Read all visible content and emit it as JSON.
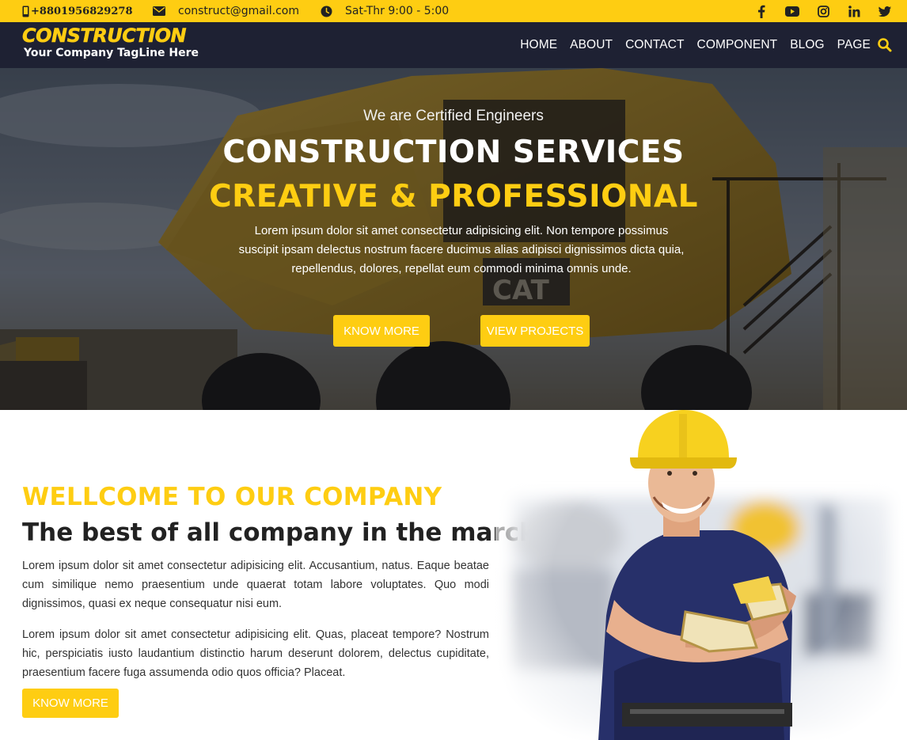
{
  "topbar": {
    "phone": "+8801956829278",
    "email": "construct@gmail.com",
    "hours": "Sat-Thr 9:00 - 5:00",
    "icons": [
      "phone-icon",
      "envelope-icon",
      "clock-icon"
    ],
    "socials": [
      "facebook-icon",
      "youtube-icon",
      "instagram-icon",
      "linkedin-icon",
      "twitter-icon"
    ]
  },
  "brand": {
    "title": "CONSTRUCTION",
    "tagline": "Your Company TagLine Here"
  },
  "nav": {
    "items": [
      "HOME",
      "ABOUT",
      "CONTACT",
      "COMPONENT",
      "BLOG",
      "PAGE"
    ],
    "search_icon": "search-icon"
  },
  "hero": {
    "kicker": "We are Certified Engineers",
    "title": "CONSTRUCTION SERVICES",
    "subtitle": "CREATIVE & PROFESSIONAL",
    "text": "Lorem ipsum dolor sit amet consectetur adipisicing elit. Non tempore possimus suscipit ipsam delectus nostrum facere ducimus alias adipisci dignissimos dicta quia, repellendus, dolores, repellat eum commodi minima omnis unde.",
    "btn_primary": "KNOW MORE",
    "btn_secondary": "VIEW PROJECTS"
  },
  "about": {
    "heading": "WELLCOME TO OUR COMPANY",
    "subheading": "The best of all company in the marcket",
    "p1": "Lorem ipsum dolor sit amet consectetur adipisicing elit. Accusantium, natus. Eaque beatae cum similique nemo praesentium unde quaerat totam labore voluptates. Quo modi dignissimos, quasi ex neque consequatur nisi eum.",
    "p2": "Lorem ipsum dolor sit amet consectetur adipisicing elit. Quas, placeat tempore? Nostrum hic, perspiciatis iusto laudantium distinctio harum deserunt dolorem, delectus cupiditate, praesentium facere fuga assumenda odio quos officia? Placeat.",
    "btn": "KNOW MORE"
  },
  "colors": {
    "accent": "#fecd12",
    "navbar": "#1e2133",
    "text_dark": "#222222"
  }
}
